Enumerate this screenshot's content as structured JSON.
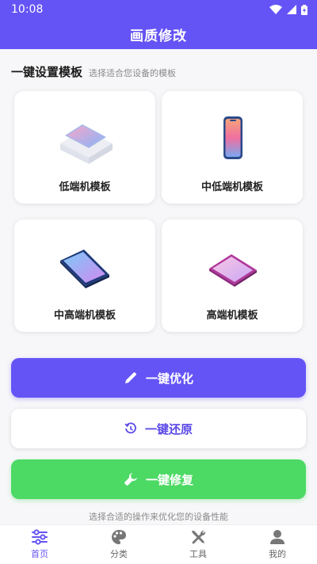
{
  "status": {
    "time": "10:08"
  },
  "app": {
    "title": "画质修改"
  },
  "section": {
    "title": "一键设置模板",
    "subtitle": "选择适合您设备的模板"
  },
  "templates": [
    {
      "label": "低端机模板"
    },
    {
      "label": "中低端机模板"
    },
    {
      "label": "中高端机模板"
    },
    {
      "label": "高端机模板"
    }
  ],
  "actions": {
    "optimize": "一键优化",
    "restore": "一键还原",
    "repair": "一键修复"
  },
  "hint": "选择合适的操作来优化您的设备性能",
  "tabs": [
    {
      "label": "首页",
      "icon": "sliders-icon",
      "active": true
    },
    {
      "label": "分类",
      "icon": "palette-icon",
      "active": false
    },
    {
      "label": "工具",
      "icon": "tools-icon",
      "active": false
    },
    {
      "label": "我的",
      "icon": "person-icon",
      "active": false
    }
  ],
  "colors": {
    "primary": "#6554f5",
    "success": "#4cd964"
  }
}
